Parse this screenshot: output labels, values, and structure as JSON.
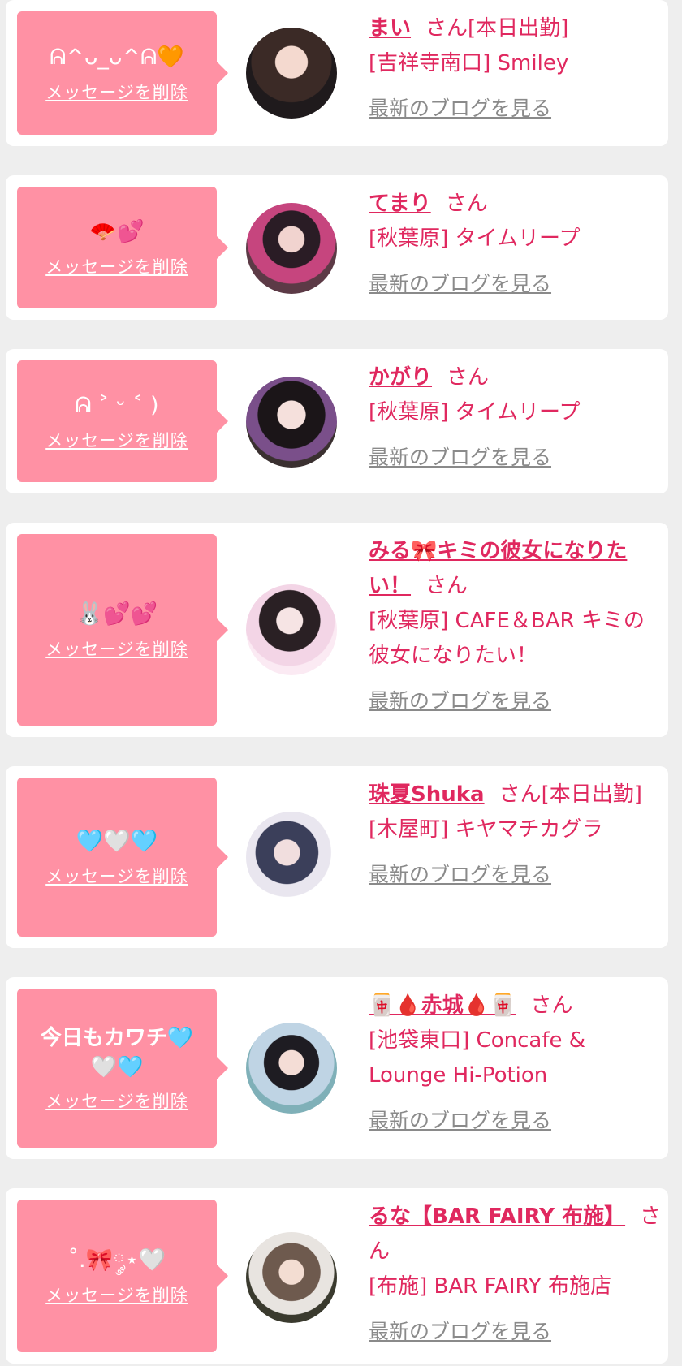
{
  "colors": {
    "accent": "#e0285f",
    "bubble": "#ff91a4",
    "blog_link": "#8a8a8a",
    "background": "#eeeeee"
  },
  "delete_label": "メッセージを削除",
  "blog_label": "最新のブログを見る",
  "san_label": "さん",
  "cards": [
    {
      "message": "ᕱ^ᴗ_ᴗ^ᕱ🧡",
      "name": "まい",
      "suffix": "さん[本日出勤]",
      "shop": "[吉祥寺南口] Smiley",
      "avatar_icon": "avatar-photo"
    },
    {
      "message": "🪭💕",
      "name": "てまり",
      "suffix": "さん",
      "shop": "[秋葉原] タイムリープ",
      "avatar_icon": "avatar-photo"
    },
    {
      "message": "ᕱ ˃ ᵕ ˂ )",
      "name": "かがり",
      "suffix": "さん",
      "shop": "[秋葉原] タイムリープ",
      "avatar_icon": "avatar-photo"
    },
    {
      "message": "🐰💕💕",
      "name": "みる🎀キミの彼女になりたい！",
      "suffix": "さん",
      "shop": "[秋葉原] CAFE＆BAR キミの彼女になりたい！",
      "avatar_icon": "avatar-photo"
    },
    {
      "message": "🩵🤍🩵",
      "name": "珠夏Shuka",
      "suffix": "さん[本日出勤]",
      "shop": "[木屋町] キヤマチカグラ",
      "avatar_icon": "avatar-photo"
    },
    {
      "message": "今日もカワチ🩵🤍🩵",
      "name": "🀄🩸赤城🩸🀄",
      "suffix": "さん",
      "shop": "[池袋東口] Concafe & Lounge Hi-Potion",
      "avatar_icon": "avatar-photo"
    },
    {
      "message": "˚.🎀༘⋆🤍",
      "name": "るな【BAR FAIRY 布施】",
      "suffix": "さん",
      "shop": "[布施] BAR FAIRY 布施店",
      "avatar_icon": "avatar-photo"
    }
  ]
}
